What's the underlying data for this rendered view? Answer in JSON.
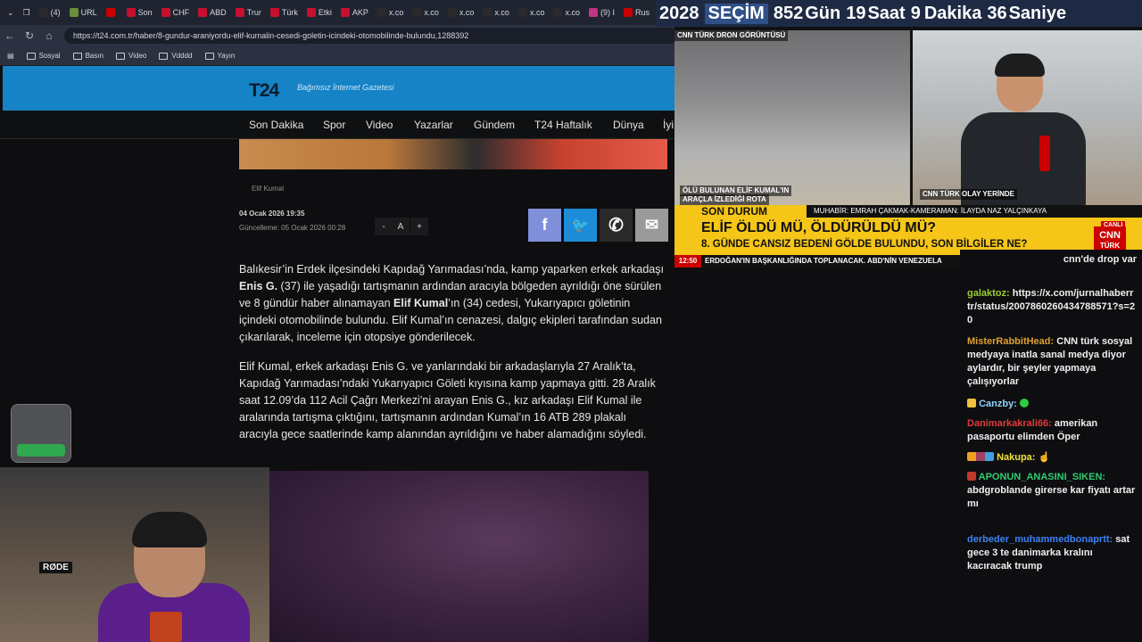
{
  "countdown": {
    "year": "2028",
    "election": "SEÇİM",
    "days_value": "852",
    "days_label": "Gün",
    "hours_value": "19",
    "hours_label": "Saat",
    "minutes_value": "9",
    "minutes_label": "Dakika",
    "seconds_value": "36",
    "seconds_label": "Saniye"
  },
  "browser": {
    "tabs": [
      {
        "label": "(4)",
        "icon": "x-icon",
        "color": "#2a2a2a"
      },
      {
        "label": "URL",
        "icon": "page-icon",
        "color": "#6a8f3a"
      },
      {
        "label": "",
        "icon": "youtube-icon",
        "color": "#cc0000"
      },
      {
        "label": "Son",
        "icon": "news-icon",
        "color": "#c8102e"
      },
      {
        "label": "CHF",
        "icon": "news-icon",
        "color": "#c8102e"
      },
      {
        "label": "ABD",
        "icon": "news-icon",
        "color": "#c8102e"
      },
      {
        "label": "Trur",
        "icon": "news-icon",
        "color": "#c8102e"
      },
      {
        "label": "Türk",
        "icon": "news-icon",
        "color": "#c8102e"
      },
      {
        "label": "Etki",
        "icon": "news-icon",
        "color": "#c8102e"
      },
      {
        "label": "AKP",
        "icon": "news-icon",
        "color": "#c8102e"
      },
      {
        "label": "x.co",
        "icon": "x-icon",
        "color": "#2a2a2a"
      },
      {
        "label": "x.co",
        "icon": "x-icon",
        "color": "#2a2a2a"
      },
      {
        "label": "x.co",
        "icon": "x-icon",
        "color": "#2a2a2a"
      },
      {
        "label": "x.co",
        "icon": "x-icon",
        "color": "#2a2a2a"
      },
      {
        "label": "x.co",
        "icon": "x-icon",
        "color": "#2a2a2a"
      },
      {
        "label": "x.co",
        "icon": "x-icon",
        "color": "#2a2a2a"
      },
      {
        "label": "(9) I",
        "icon": "instagram-icon",
        "color": "#c13584"
      },
      {
        "label": "Rus",
        "icon": "youtube-icon",
        "color": "#cc0000"
      }
    ],
    "url": "https://t24.com.tr/haber/8-gundur-araniyordu-elif-kumalin-cesedi-goletin-icindeki-otomobilinde-bulundu,1288392",
    "bookmarks": [
      "Sosyal",
      "Basın",
      "Video",
      "Vdddd",
      "Yayın"
    ]
  },
  "site": {
    "logo": "T24",
    "tagline": "Bağımsız İnternet Gazetesi",
    "nav": [
      "Son Dakika",
      "Spor",
      "Video",
      "Yazarlar",
      "Gündem",
      "T24 Haftalık",
      "Dünya",
      "İyi"
    ],
    "photo_credit": "Elif Kumal",
    "date": "04 Ocak 2026 19:35",
    "updated": "Güncelleme: 05 Ocak 2026 00:28",
    "font_controls": [
      "-",
      "A",
      "+"
    ],
    "share": [
      {
        "name": "facebook",
        "glyph": "f",
        "color": "#7f8fd9"
      },
      {
        "name": "twitter",
        "glyph": "🐦",
        "color": "#1d8cd8"
      },
      {
        "name": "whatsapp",
        "glyph": "✆",
        "color": "#2a2a2a"
      },
      {
        "name": "email",
        "glyph": "✉",
        "color": "#9a9a9a"
      }
    ],
    "paragraph1": {
      "t1": "Balıkesir’in Erdek ilçesindeki Kapıdağ Yarımadası’nda, kamp yaparken erkek arkadaşı ",
      "b1": "Enis G.",
      "t2": " (37) ile yaşadığı tartışmanın ardından aracıyla bölgeden ayrıldığı öne sürülen ve 8 gündür haber alınamayan ",
      "b2": "Elif Kumal",
      "t3": "’ın (34) cedesi, Yukarıyapıcı göletinin içindeki otomobilinde bulundu. Elif Kumal’ın cenazesi, dalgıç ekipleri tarafından sudan çıkarılarak, inceleme için otopsiye gönderilecek."
    },
    "paragraph2": "Elif Kumal, erkek arkadaşı Enis G. ve yanlarındaki bir arkadaşlarıyla 27 Aralık’ta, Kapıdağ Yarımadası’ndaki Yukarıyapıcı Göleti kıyısına kamp yapmaya gitti. 28 Aralık saat 12.09’da 112 Acil Çağrı Merkezi’ni arayan Enis G., kız arkadaşı Elif Kumal ile aralarında tartışma çıktığını, tartışmanın ardından Kumal’ın 16 ATB 289 plakalı aracıyla gece saatlerinde kamp alanından ayrıldığını ve haber alamadığını söyledi."
  },
  "webcam": {
    "mic_brand": "RØDE"
  },
  "tv": {
    "left_caption_top": "CNN TÜRK DRON GÖRÜNTÜSÜ",
    "left_caption_bottom_1": "ÖLÜ BULUNAN ELİF KUMAL'IN",
    "left_caption_bottom_2": "ARAÇLA İZLEDİĞİ ROTA",
    "right_caption": "CNN TÜRK OLAY YERİNDE",
    "son_durum": "SON DURUM",
    "muhabir": "MUHABİR: EMRAH ÇAKMAK-KAMERAMAN: İLAYDA NAZ YALÇINKAYA",
    "headline": "ELİF ÖLDÜ MÜ, ÖLDÜRÜLDÜ MÜ?",
    "subheadline": "8. GÜNDE CANSIZ BEDENİ GÖLDE BULUNDU, SON BİLGİLER NE?",
    "live": "CANLI",
    "logo_top": "CNN",
    "logo_bottom": "TÜRK",
    "ticker_time": "12:50",
    "ticker_text": "ERDOĞAN'IN BAŞKANLIĞINDA TOPLANACAK. ABD'NİN VENEZUELA"
  },
  "chat": {
    "messages": [
      {
        "user": "",
        "text": "cnn'de drop var",
        "user_color": "#e03a3a"
      },
      {
        "user": "galaktoz:",
        "text": "https://x.com/jurnalhaberrtr/status/2007860260434788571?s=20",
        "user_color": "#9acd32"
      },
      {
        "user": "MisterRabbitHead:",
        "text": "CNN türk sosyal medyaya inatla sanal medya diyor aylardır, bir şeyler yapmaya çalışıyorlar",
        "user_color": "#e0a030"
      },
      {
        "user": "Canzby:",
        "text": "",
        "user_color": "#8fd3ff"
      },
      {
        "user": "Danimarkakrali66:",
        "text": "amerikan pasaportu elimden Öper",
        "user_color": "#e03a3a"
      },
      {
        "user": "Nakupa:",
        "text": "",
        "user_color": "#f0e040"
      },
      {
        "user": "APONUN_ANASINI_SIKEN:",
        "text": "abdgroblande girerse kar fiyatı artar mı",
        "user_color": "#2ecc71"
      },
      {
        "user": "derbeder_muhammedbonaprtt:",
        "text": "sat gece 3 te danimarka kralını kacıracak trump",
        "user_color": "#3b82f6"
      }
    ]
  }
}
